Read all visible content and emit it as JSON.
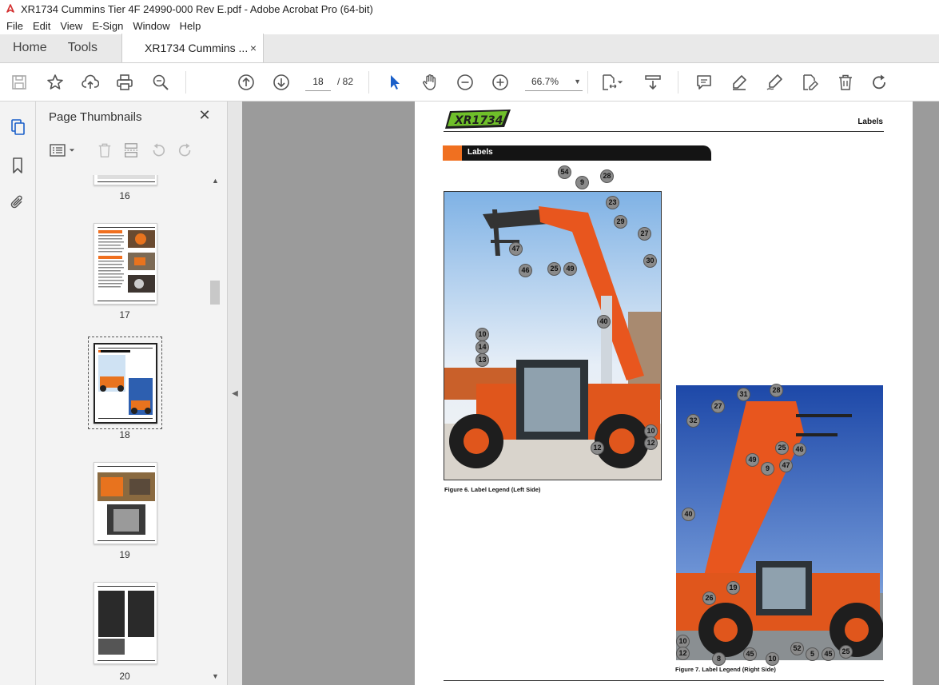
{
  "window": {
    "title": "XR1734 Cummins Tier 4F 24990-000 Rev E.pdf - Adobe Acrobat Pro (64-bit)",
    "accent": "#d32f2f"
  },
  "menu": [
    "File",
    "Edit",
    "View",
    "E-Sign",
    "Window",
    "Help"
  ],
  "tabs": {
    "home": "Home",
    "tools": "Tools",
    "document": "XR1734 Cummins ...",
    "close_glyph": "×"
  },
  "toolbar": {
    "current_page": "18",
    "total_pages": "/ 82",
    "zoom": "66.7%",
    "icons": [
      "save-icon",
      "bookmark-star-icon",
      "upload-cloud-icon",
      "print-icon",
      "zoom-search-icon",
      "prev-page-icon",
      "next-page-icon",
      "select-cursor-icon",
      "hand-icon",
      "zoom-out-icon",
      "zoom-in-icon",
      "page-fit-icon",
      "scroll-mode-icon",
      "comment-icon",
      "highlight-pen-icon",
      "sign-pen-icon",
      "edit-pdf-icon",
      "delete-icon",
      "redo-icon"
    ]
  },
  "thumbnails": {
    "panel_title": "Page Thumbnails",
    "close_glyph": "✕",
    "pages": [
      {
        "label": "16"
      },
      {
        "label": "17"
      },
      {
        "label": "18",
        "selected": true
      },
      {
        "label": "19"
      },
      {
        "label": "20"
      }
    ]
  },
  "document": {
    "logo_text": "XR1734",
    "header_title": "Labels",
    "section_title": "Labels",
    "figure6_caption": "Figure 6. Label Legend (Left Side)",
    "figure7_caption": "Figure 7. Label Legend (Right Side)",
    "callouts_left": [
      "54",
      "9",
      "28",
      "23",
      "29",
      "27",
      "30",
      "47",
      "46",
      "25",
      "49",
      "40",
      "10",
      "14",
      "13",
      "10",
      "12",
      "12"
    ],
    "callouts_right": [
      "31",
      "28",
      "27",
      "32",
      "25",
      "46",
      "49",
      "47",
      "9",
      "40",
      "19",
      "26",
      "10",
      "12",
      "8",
      "45",
      "10",
      "52",
      "5",
      "45",
      "25"
    ]
  }
}
